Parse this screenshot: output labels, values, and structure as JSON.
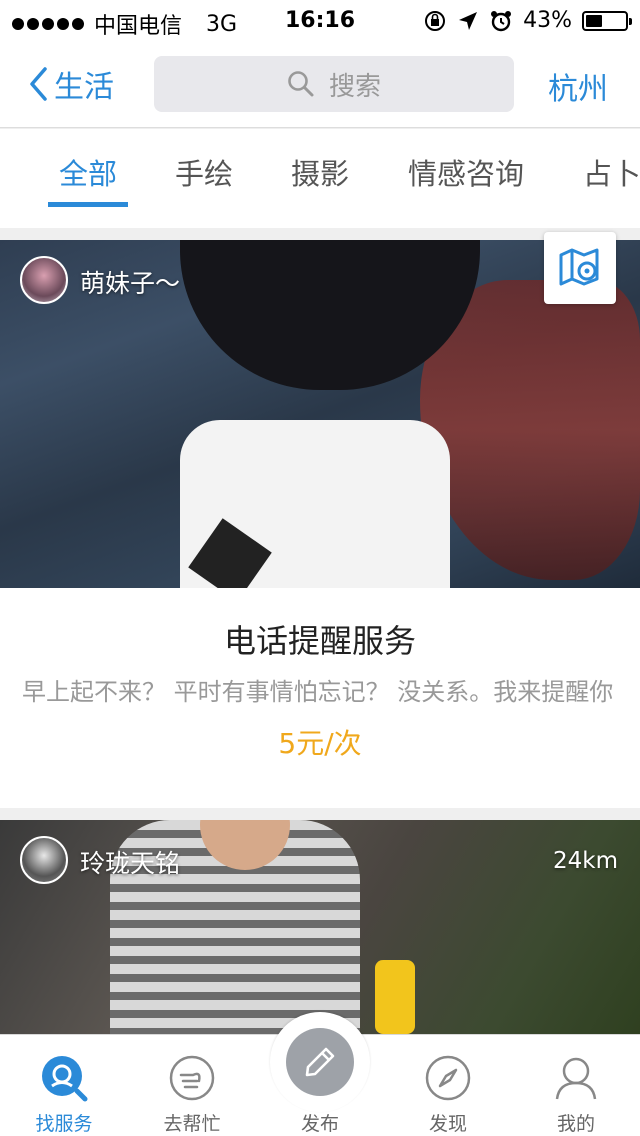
{
  "status_bar": {
    "carrier": "中国电信",
    "network": "3G",
    "time": "16:16",
    "battery": "43%",
    "battery_level": 0.43
  },
  "nav": {
    "back_label": "生活",
    "search_placeholder": "搜索",
    "city": "杭州"
  },
  "tabs": [
    {
      "label": "全部",
      "active": true
    },
    {
      "label": "手绘",
      "active": false
    },
    {
      "label": "摄影",
      "active": false
    },
    {
      "label": "情感咨询",
      "active": false
    },
    {
      "label": "占卜",
      "active": false
    }
  ],
  "cards": [
    {
      "user": "萌妹子～",
      "title": "电话提醒服务",
      "description": "早上起不来？ 平时有事情怕忘记？ 没关系。我来提醒你",
      "price": "5元/次"
    },
    {
      "user": "玲珑天铭",
      "distance": "24km"
    }
  ],
  "tab_bar": [
    {
      "label": "找服务",
      "icon": "find-service-icon",
      "active": true
    },
    {
      "label": "去帮忙",
      "icon": "help-hand-icon",
      "active": false
    },
    {
      "label": "发布",
      "icon": "pencil-icon",
      "active": false
    },
    {
      "label": "发现",
      "icon": "compass-icon",
      "active": false
    },
    {
      "label": "我的",
      "icon": "person-icon",
      "active": false
    }
  ],
  "colors": {
    "accent": "#2b8ad8",
    "price": "#f0a81c",
    "publish_button": "#9ea2a8"
  }
}
